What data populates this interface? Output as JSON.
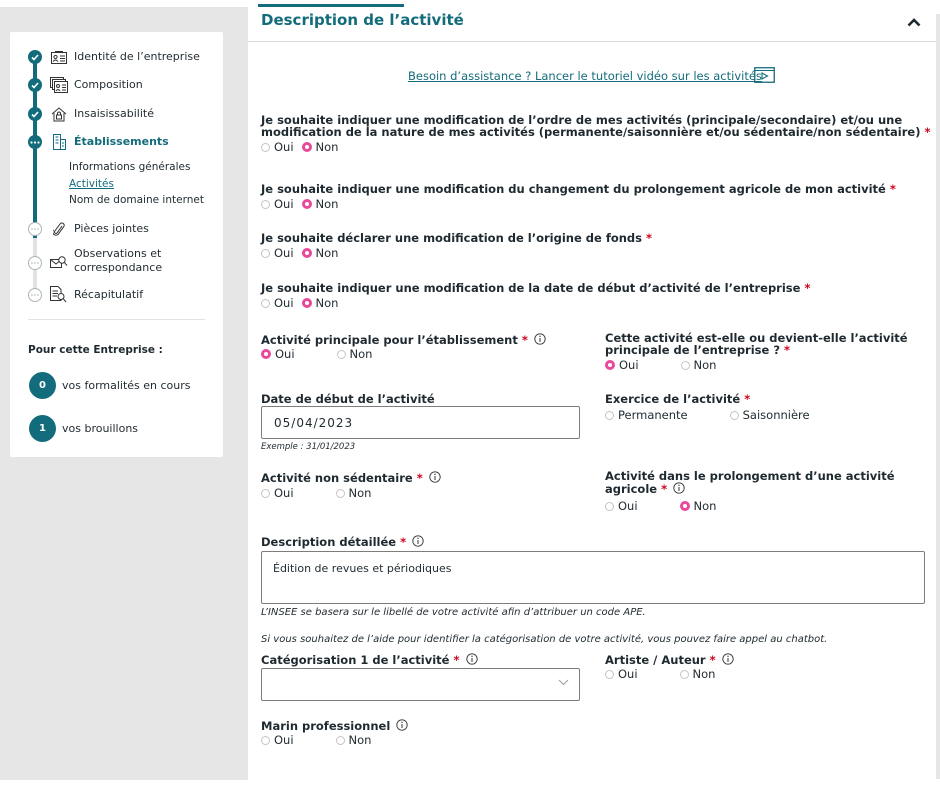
{
  "sidebar": {
    "steps": [
      {
        "label": "Identité de l’entreprise",
        "status": "done",
        "icon": "id-card-icon"
      },
      {
        "label": "Composition",
        "status": "done",
        "icon": "id-cards-stack-icon"
      },
      {
        "label": "Insaisissabilité",
        "status": "done",
        "icon": "house-lock-icon"
      },
      {
        "label": "Établissements",
        "status": "current",
        "icon": "building-icon"
      },
      {
        "label": "Pièces jointes",
        "status": "pending",
        "icon": "paperclip-icon"
      },
      {
        "label": "Observations et correspondance",
        "label_line1": "Observations et",
        "label_line2": "correspondance",
        "status": "pending",
        "icon": "mail-search-icon"
      },
      {
        "label": "Récapitulatif",
        "status": "pending",
        "icon": "document-search-icon"
      }
    ],
    "substeps": [
      {
        "label": "Informations générales",
        "active": false
      },
      {
        "label": "Activités",
        "active": true
      },
      {
        "label": "Nom de domaine internet",
        "active": false
      }
    ],
    "company_title": "Pour cette Entreprise :",
    "counters": [
      {
        "count": "0",
        "label": "vos formalités en cours"
      },
      {
        "count": "1",
        "label": "vos brouillons"
      }
    ]
  },
  "section": {
    "title": "Description de l’activité",
    "collapse_icon": "chevron-up-icon",
    "help_link": "Besoin d’assistance ? Lancer le tutoriel vidéo sur les activités",
    "help_icon": "video-play-icon"
  },
  "questions": [
    {
      "label_line1": "Je souhaite indiquer une modification de l’ordre de mes activités (principale/secondaire) et/ou une",
      "label_line2": "modification de la nature de mes activités (permanente/saisonnière et/ou sédentaire/non sédentaire)",
      "required": "*",
      "options": [
        "Oui",
        "Non"
      ],
      "selected": "Non"
    },
    {
      "label": "Je souhaite indiquer une modification du changement du prolongement agricole de mon activité",
      "required": "*",
      "options": [
        "Oui",
        "Non"
      ],
      "selected": "Non"
    },
    {
      "label": "Je souhaite déclarer une modification de l’origine de fonds",
      "required": "*",
      "options": [
        "Oui",
        "Non"
      ],
      "selected": "Non"
    },
    {
      "label": "Je souhaite indiquer une modification de la date de début d’activité de l’entreprise",
      "required": "*",
      "options": [
        "Oui",
        "Non"
      ],
      "selected": "Non"
    }
  ],
  "fields": {
    "activite_principale": {
      "label": "Activité principale pour l’établissement",
      "required": "*",
      "options": [
        "Oui",
        "Non"
      ],
      "selected": "Oui"
    },
    "activite_principale_entreprise": {
      "label_line1": "Cette activité est-elle ou devient-elle l’activité",
      "label_line2": "principale de l’entreprise ?",
      "required": "*",
      "options": [
        "Oui",
        "Non"
      ],
      "selected": "Oui"
    },
    "date_debut": {
      "label": "Date de début de l’activité",
      "value": "05/04/2023",
      "hint": "Exemple : 31/01/2023"
    },
    "exercice": {
      "label": "Exercice de l’activité",
      "required": "*",
      "options": [
        "Permanente",
        "Saisonnière"
      ],
      "selected": null
    },
    "non_sedentaire": {
      "label": "Activité non sédentaire",
      "required": "*",
      "options": [
        "Oui",
        "Non"
      ],
      "selected": null
    },
    "prolongement_agricole": {
      "label_line1": "Activité dans le prolongement d’une activité",
      "label_line2": "agricole",
      "required": "*",
      "options": [
        "Oui",
        "Non"
      ],
      "selected": "Non"
    },
    "description": {
      "label": "Description détaillée",
      "required": "*",
      "value": "Édition de revues et périodiques",
      "hint": "L’INSEE se basera sur le libellé de votre activité afin d’attribuer un code APE."
    },
    "chatbot_hint": "Si vous souhaitez de l’aide pour identifier la catégorisation de votre activité, vous pouvez faire appel au chatbot.",
    "categorisation": {
      "label": "Catégorisation 1 de l’activité",
      "required": "*",
      "value": ""
    },
    "artiste": {
      "label": "Artiste / Auteur",
      "required": "*",
      "options": [
        "Oui",
        "Non"
      ],
      "selected": null
    },
    "marin": {
      "label": "Marin professionnel",
      "options": [
        "Oui",
        "Non"
      ],
      "selected": null
    }
  },
  "colors": {
    "brand": "#136c7b",
    "required": "#d0021b",
    "radio_selected": "#e8499a",
    "background": "#e6e6e6"
  }
}
